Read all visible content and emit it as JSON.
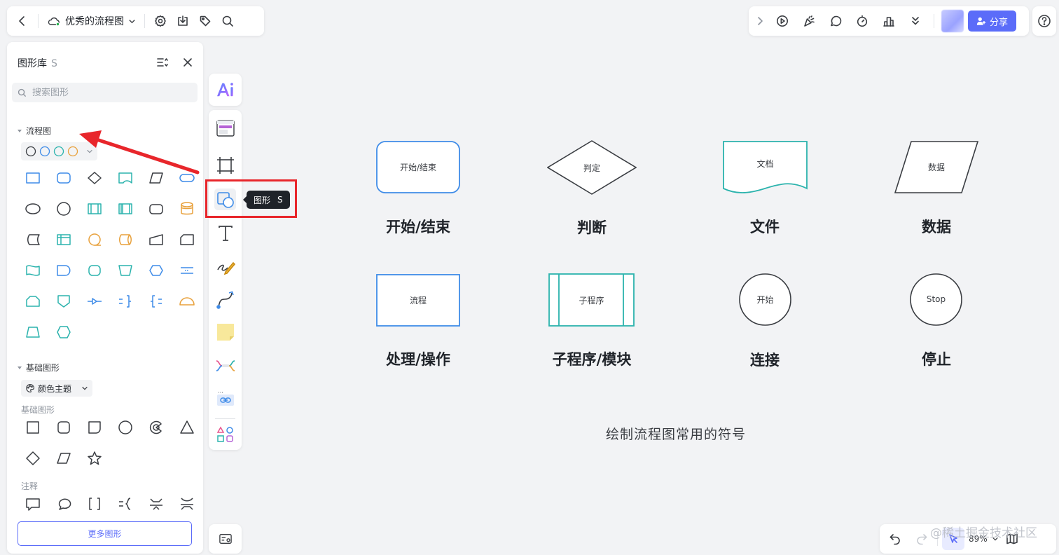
{
  "doc": {
    "name": "优秀的流程图"
  },
  "share": {
    "label": "分享"
  },
  "panel": {
    "title": "图形库",
    "shortcut": "S",
    "search_placeholder": "搜索图形",
    "section_flow": "流程图",
    "section_basic": "基础图形",
    "theme_label": "颜色主题",
    "sub_basic": "基础图形",
    "sub_note": "注释",
    "more_button": "更多图形"
  },
  "tooltip": {
    "label": "图形",
    "shortcut": "S"
  },
  "canvas": {
    "symbols": [
      {
        "inner": "开始/结束",
        "caption": "开始/结束"
      },
      {
        "inner": "判定",
        "caption": "判断"
      },
      {
        "inner": "文档",
        "caption": "文件"
      },
      {
        "inner": "数据",
        "caption": "数据"
      },
      {
        "inner": "流程",
        "caption": "处理/操作"
      },
      {
        "inner": "子程序",
        "caption": "子程序/模块"
      },
      {
        "inner": "开始",
        "caption": "连接"
      },
      {
        "inner": "Stop",
        "caption": "停止"
      }
    ],
    "caption": "绘制流程图常用的符号"
  },
  "zoom": {
    "level": "89%"
  },
  "watermark": "@稀土掘金技术社区",
  "colors": {
    "accent": "#5b6cf9",
    "blue": "#3f8ce8",
    "teal": "#2bb3ad",
    "orange": "#e8a13c",
    "highlight": "#e8262b"
  }
}
